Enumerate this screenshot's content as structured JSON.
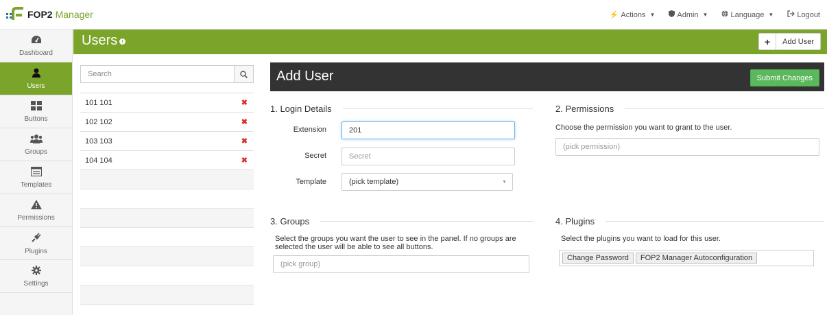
{
  "brand": {
    "fop2": "FOP2",
    "manager": "Manager"
  },
  "topnav": {
    "actions": "Actions",
    "admin": "Admin",
    "language": "Language",
    "logout": "Logout"
  },
  "sidebar": {
    "items": [
      {
        "label": "Dashboard",
        "icon": "dashboard-icon"
      },
      {
        "label": "Users",
        "icon": "user-icon"
      },
      {
        "label": "Buttons",
        "icon": "grid-icon"
      },
      {
        "label": "Groups",
        "icon": "group-icon"
      },
      {
        "label": "Templates",
        "icon": "template-icon"
      },
      {
        "label": "Permissions",
        "icon": "warning-icon"
      },
      {
        "label": "Plugins",
        "icon": "plug-icon"
      },
      {
        "label": "Settings",
        "icon": "gear-icon"
      }
    ]
  },
  "header": {
    "title": "Users",
    "add_user_label": "Add User"
  },
  "userlist": {
    "search_placeholder": "Search",
    "users": [
      "101 101",
      "102 102",
      "103 103",
      "104 104"
    ]
  },
  "form": {
    "title": "Add User",
    "submit_label": "Submit Changes",
    "login": {
      "title": "1. Login Details",
      "extension_label": "Extension",
      "extension_value": "201",
      "secret_label": "Secret",
      "secret_placeholder": "Secret",
      "template_label": "Template",
      "template_value": "(pick template)"
    },
    "permissions": {
      "title": "2. Permissions",
      "description": "Choose the permission you want to grant to the user.",
      "placeholder": "(pick permission)"
    },
    "groups": {
      "title": "3. Groups",
      "description": "Select the groups you want the user to see in the panel. If no groups are selected the user will be able to see all buttons.",
      "placeholder": "(pick group)"
    },
    "plugins": {
      "title": "4. Plugins",
      "description": "Select the plugins you want to load for this user.",
      "tags": [
        "Change Password",
        "FOP2 Manager Autoconfiguration"
      ]
    }
  },
  "colors": {
    "accent": "#7aa42a",
    "dark_header": "#333333",
    "submit": "#5cb85c",
    "delete": "#d9302c"
  }
}
